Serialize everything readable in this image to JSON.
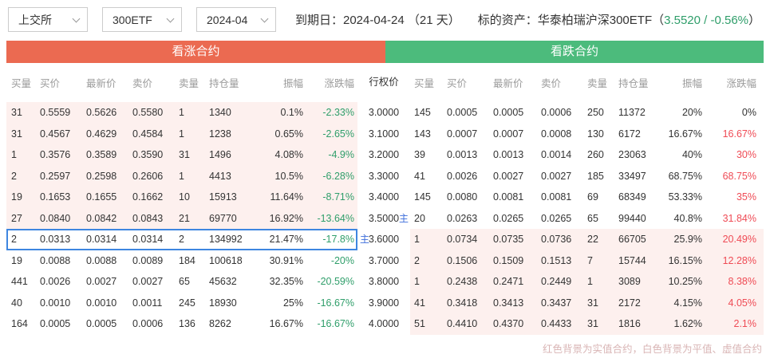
{
  "toolbar": {
    "exchange": "上交所",
    "underlying": "300ETF",
    "month": "2024-04",
    "expiry_label": "到期日：2024-04-24 （21 天）",
    "asset_prefix": "标的资产：华泰柏瑞沪深300ETF（",
    "asset_quote": "3.5520 / -0.56%",
    "asset_suffix": "）"
  },
  "sections": {
    "calls": "看涨合约",
    "puts": "看跌合约"
  },
  "columns": {
    "call": [
      "买量",
      "买价",
      "最新价",
      "卖价",
      "卖量",
      "持仓量",
      "振幅",
      "涨跌幅"
    ],
    "strike": "行权价",
    "put": [
      "买量",
      "买价",
      "最新价",
      "卖价",
      "卖量",
      "持仓量",
      "振幅",
      "涨跌幅"
    ]
  },
  "labels": {
    "main": "主"
  },
  "colors": {
    "call_header_bg": "#eb6a51",
    "put_header_bg": "#4cbb7c",
    "itm_row_bg": "#fdf0ee",
    "up_text": "#ef4b55",
    "down_text": "#2f9e6a",
    "quote_green": "#2f9e6a",
    "highlight_border": "#3e86e0",
    "main_badge": "#3d6edb"
  },
  "rows": [
    {
      "strike": "3.0000",
      "main_call": false,
      "main_put": false,
      "highlight": false,
      "call": {
        "itm": true,
        "bid_vol": "31",
        "bid": "0.5559",
        "last": "0.5626",
        "ask": "0.5580",
        "ask_vol": "1",
        "oi": "1340",
        "amp": "0.1%",
        "chg": "-2.33%",
        "chg_dir": "down"
      },
      "put": {
        "itm": false,
        "bid_vol": "145",
        "bid": "0.0005",
        "last": "0.0005",
        "ask": "0.0006",
        "ask_vol": "250",
        "oi": "11372",
        "amp": "20%",
        "chg": "0%",
        "chg_dir": "flat"
      }
    },
    {
      "strike": "3.1000",
      "main_call": false,
      "main_put": false,
      "highlight": false,
      "call": {
        "itm": true,
        "bid_vol": "31",
        "bid": "0.4567",
        "last": "0.4629",
        "ask": "0.4584",
        "ask_vol": "1",
        "oi": "1238",
        "amp": "0.65%",
        "chg": "-2.65%",
        "chg_dir": "down"
      },
      "put": {
        "itm": false,
        "bid_vol": "143",
        "bid": "0.0007",
        "last": "0.0007",
        "ask": "0.0008",
        "ask_vol": "130",
        "oi": "6172",
        "amp": "16.67%",
        "chg": "16.67%",
        "chg_dir": "up"
      }
    },
    {
      "strike": "3.2000",
      "main_call": false,
      "main_put": false,
      "highlight": false,
      "call": {
        "itm": true,
        "bid_vol": "1",
        "bid": "0.3576",
        "last": "0.3589",
        "ask": "0.3590",
        "ask_vol": "31",
        "oi": "1496",
        "amp": "4.08%",
        "chg": "-4.9%",
        "chg_dir": "down"
      },
      "put": {
        "itm": false,
        "bid_vol": "39",
        "bid": "0.0013",
        "last": "0.0013",
        "ask": "0.0014",
        "ask_vol": "260",
        "oi": "23063",
        "amp": "40%",
        "chg": "30%",
        "chg_dir": "up"
      }
    },
    {
      "strike": "3.3000",
      "main_call": false,
      "main_put": false,
      "highlight": false,
      "call": {
        "itm": true,
        "bid_vol": "2",
        "bid": "0.2597",
        "last": "0.2598",
        "ask": "0.2606",
        "ask_vol": "1",
        "oi": "4413",
        "amp": "10.5%",
        "chg": "-6.28%",
        "chg_dir": "down"
      },
      "put": {
        "itm": false,
        "bid_vol": "41",
        "bid": "0.0026",
        "last": "0.0027",
        "ask": "0.0027",
        "ask_vol": "185",
        "oi": "33497",
        "amp": "68.75%",
        "chg": "68.75%",
        "chg_dir": "up"
      }
    },
    {
      "strike": "3.4000",
      "main_call": false,
      "main_put": false,
      "highlight": false,
      "call": {
        "itm": true,
        "bid_vol": "19",
        "bid": "0.1653",
        "last": "0.1655",
        "ask": "0.1662",
        "ask_vol": "10",
        "oi": "15913",
        "amp": "11.64%",
        "chg": "-8.71%",
        "chg_dir": "down"
      },
      "put": {
        "itm": false,
        "bid_vol": "145",
        "bid": "0.0080",
        "last": "0.0081",
        "ask": "0.0081",
        "ask_vol": "69",
        "oi": "68349",
        "amp": "53.33%",
        "chg": "35%",
        "chg_dir": "up"
      }
    },
    {
      "strike": "3.5000",
      "main_call": false,
      "main_put": true,
      "highlight": false,
      "call": {
        "itm": true,
        "bid_vol": "27",
        "bid": "0.0840",
        "last": "0.0842",
        "ask": "0.0843",
        "ask_vol": "21",
        "oi": "69770",
        "amp": "16.92%",
        "chg": "-13.64%",
        "chg_dir": "down"
      },
      "put": {
        "itm": false,
        "bid_vol": "20",
        "bid": "0.0263",
        "last": "0.0265",
        "ask": "0.0265",
        "ask_vol": "65",
        "oi": "99440",
        "amp": "40.8%",
        "chg": "31.84%",
        "chg_dir": "up"
      }
    },
    {
      "strike": "3.6000",
      "main_call": true,
      "main_put": false,
      "highlight": true,
      "call": {
        "itm": false,
        "bid_vol": "2",
        "bid": "0.0313",
        "last": "0.0314",
        "ask": "0.0314",
        "ask_vol": "2",
        "oi": "134992",
        "amp": "21.47%",
        "chg": "-17.8%",
        "chg_dir": "down"
      },
      "put": {
        "itm": true,
        "bid_vol": "1",
        "bid": "0.0734",
        "last": "0.0735",
        "ask": "0.0736",
        "ask_vol": "22",
        "oi": "66705",
        "amp": "25.9%",
        "chg": "20.49%",
        "chg_dir": "up"
      }
    },
    {
      "strike": "3.7000",
      "main_call": false,
      "main_put": false,
      "highlight": false,
      "call": {
        "itm": false,
        "bid_vol": "19",
        "bid": "0.0088",
        "last": "0.0088",
        "ask": "0.0089",
        "ask_vol": "184",
        "oi": "100618",
        "amp": "30.91%",
        "chg": "-20%",
        "chg_dir": "down"
      },
      "put": {
        "itm": true,
        "bid_vol": "2",
        "bid": "0.1506",
        "last": "0.1509",
        "ask": "0.1513",
        "ask_vol": "7",
        "oi": "15744",
        "amp": "16.15%",
        "chg": "12.28%",
        "chg_dir": "up"
      }
    },
    {
      "strike": "3.8000",
      "main_call": false,
      "main_put": false,
      "highlight": false,
      "call": {
        "itm": false,
        "bid_vol": "441",
        "bid": "0.0026",
        "last": "0.0027",
        "ask": "0.0027",
        "ask_vol": "65",
        "oi": "45632",
        "amp": "32.35%",
        "chg": "-20.59%",
        "chg_dir": "down"
      },
      "put": {
        "itm": true,
        "bid_vol": "1",
        "bid": "0.2438",
        "last": "0.2471",
        "ask": "0.2449",
        "ask_vol": "1",
        "oi": "3089",
        "amp": "10.25%",
        "chg": "8.38%",
        "chg_dir": "up"
      }
    },
    {
      "strike": "3.9000",
      "main_call": false,
      "main_put": false,
      "highlight": false,
      "call": {
        "itm": false,
        "bid_vol": "40",
        "bid": "0.0010",
        "last": "0.0010",
        "ask": "0.0011",
        "ask_vol": "245",
        "oi": "18930",
        "amp": "25%",
        "chg": "-16.67%",
        "chg_dir": "down"
      },
      "put": {
        "itm": true,
        "bid_vol": "41",
        "bid": "0.3418",
        "last": "0.3413",
        "ask": "0.3437",
        "ask_vol": "31",
        "oi": "2172",
        "amp": "4.15%",
        "chg": "4.05%",
        "chg_dir": "up"
      }
    },
    {
      "strike": "4.0000",
      "main_call": false,
      "main_put": false,
      "highlight": false,
      "call": {
        "itm": false,
        "bid_vol": "164",
        "bid": "0.0005",
        "last": "0.0005",
        "ask": "0.0006",
        "ask_vol": "136",
        "oi": "8262",
        "amp": "16.67%",
        "chg": "-16.67%",
        "chg_dir": "down"
      },
      "put": {
        "itm": true,
        "bid_vol": "51",
        "bid": "0.4410",
        "last": "0.4370",
        "ask": "0.4433",
        "ask_vol": "31",
        "oi": "1816",
        "amp": "1.62%",
        "chg": "2.1%",
        "chg_dir": "up"
      }
    }
  ],
  "footnote": "红色背景为实值合约，白色背景为平值、虚值合约"
}
